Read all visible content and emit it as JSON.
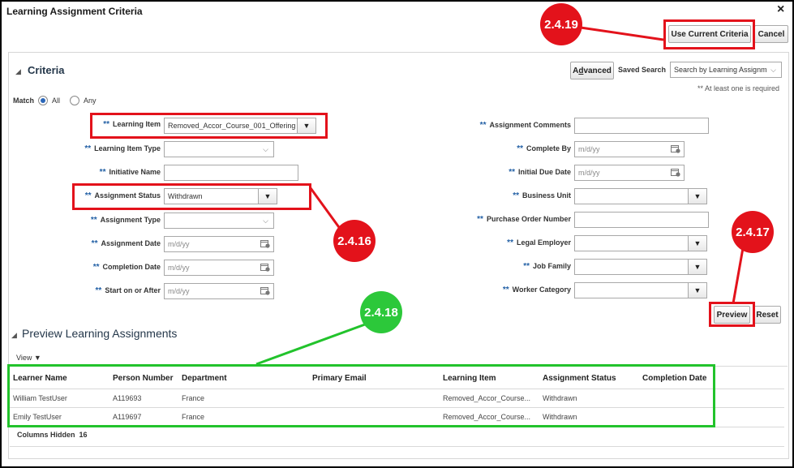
{
  "dialog": {
    "title": "Learning Assignment Criteria",
    "close_label": "×"
  },
  "buttons": {
    "use_current": "Use Current Criteria",
    "cancel": "Cancel",
    "advanced_prefix": "A",
    "advanced_underline": "d",
    "advanced_suffix": "vanced",
    "preview": "Preview",
    "reset": "Reset"
  },
  "saved_search": {
    "label": "Saved Search",
    "value": "Search by Learning Assignm"
  },
  "criteria": {
    "title": "Criteria",
    "required_note": "** At least one is required",
    "match_label": "Match",
    "match_all": "All",
    "match_any": "Any",
    "star": "**",
    "left": [
      {
        "label": "Learning Item",
        "value": "Removed_Accor_Course_001_Offering"
      },
      {
        "label": "Learning Item Type",
        "value": ""
      },
      {
        "label": "Initiative Name",
        "value": ""
      },
      {
        "label": "Assignment Status",
        "value": "Withdrawn"
      },
      {
        "label": "Assignment Type",
        "value": ""
      },
      {
        "label": "Assignment Date",
        "placeholder": "m/d/yy"
      },
      {
        "label": "Completion Date",
        "placeholder": "m/d/yy"
      },
      {
        "label": "Start on or After",
        "placeholder": "m/d/yy"
      }
    ],
    "right": [
      {
        "label": "Assignment Comments",
        "value": ""
      },
      {
        "label": "Complete By",
        "placeholder": "m/d/yy"
      },
      {
        "label": "Initial Due Date",
        "placeholder": "m/d/yy"
      },
      {
        "label": "Business Unit",
        "value": ""
      },
      {
        "label": "Purchase Order Number",
        "value": ""
      },
      {
        "label": "Legal Employer",
        "value": ""
      },
      {
        "label": "Job Family",
        "value": ""
      },
      {
        "label": "Worker Category",
        "value": ""
      }
    ]
  },
  "preview": {
    "title": "Preview Learning Assignments",
    "view_label": "View",
    "columns": [
      "Learner Name",
      "Person Number",
      "Department",
      "Primary Email",
      "Learning Item",
      "Assignment Status",
      "Completion Date"
    ],
    "rows": [
      [
        "William TestUser",
        "A119693",
        "France",
        "",
        "Removed_Accor_Course...",
        "Withdrawn",
        ""
      ],
      [
        "Emily TestUser",
        "A119697",
        "France",
        "",
        "Removed_Accor_Course...",
        "Withdrawn",
        ""
      ]
    ],
    "columns_hidden_label": "Columns Hidden",
    "columns_hidden_count": "16"
  },
  "annotations": {
    "step_2419": "2.4.19",
    "step_2416": "2.4.16",
    "step_2417": "2.4.17",
    "step_2418": "2.4.18"
  },
  "colors": {
    "annotation_red": "#e3121b",
    "annotation_green": "#22c32c",
    "link_blue": "#2360a5"
  }
}
